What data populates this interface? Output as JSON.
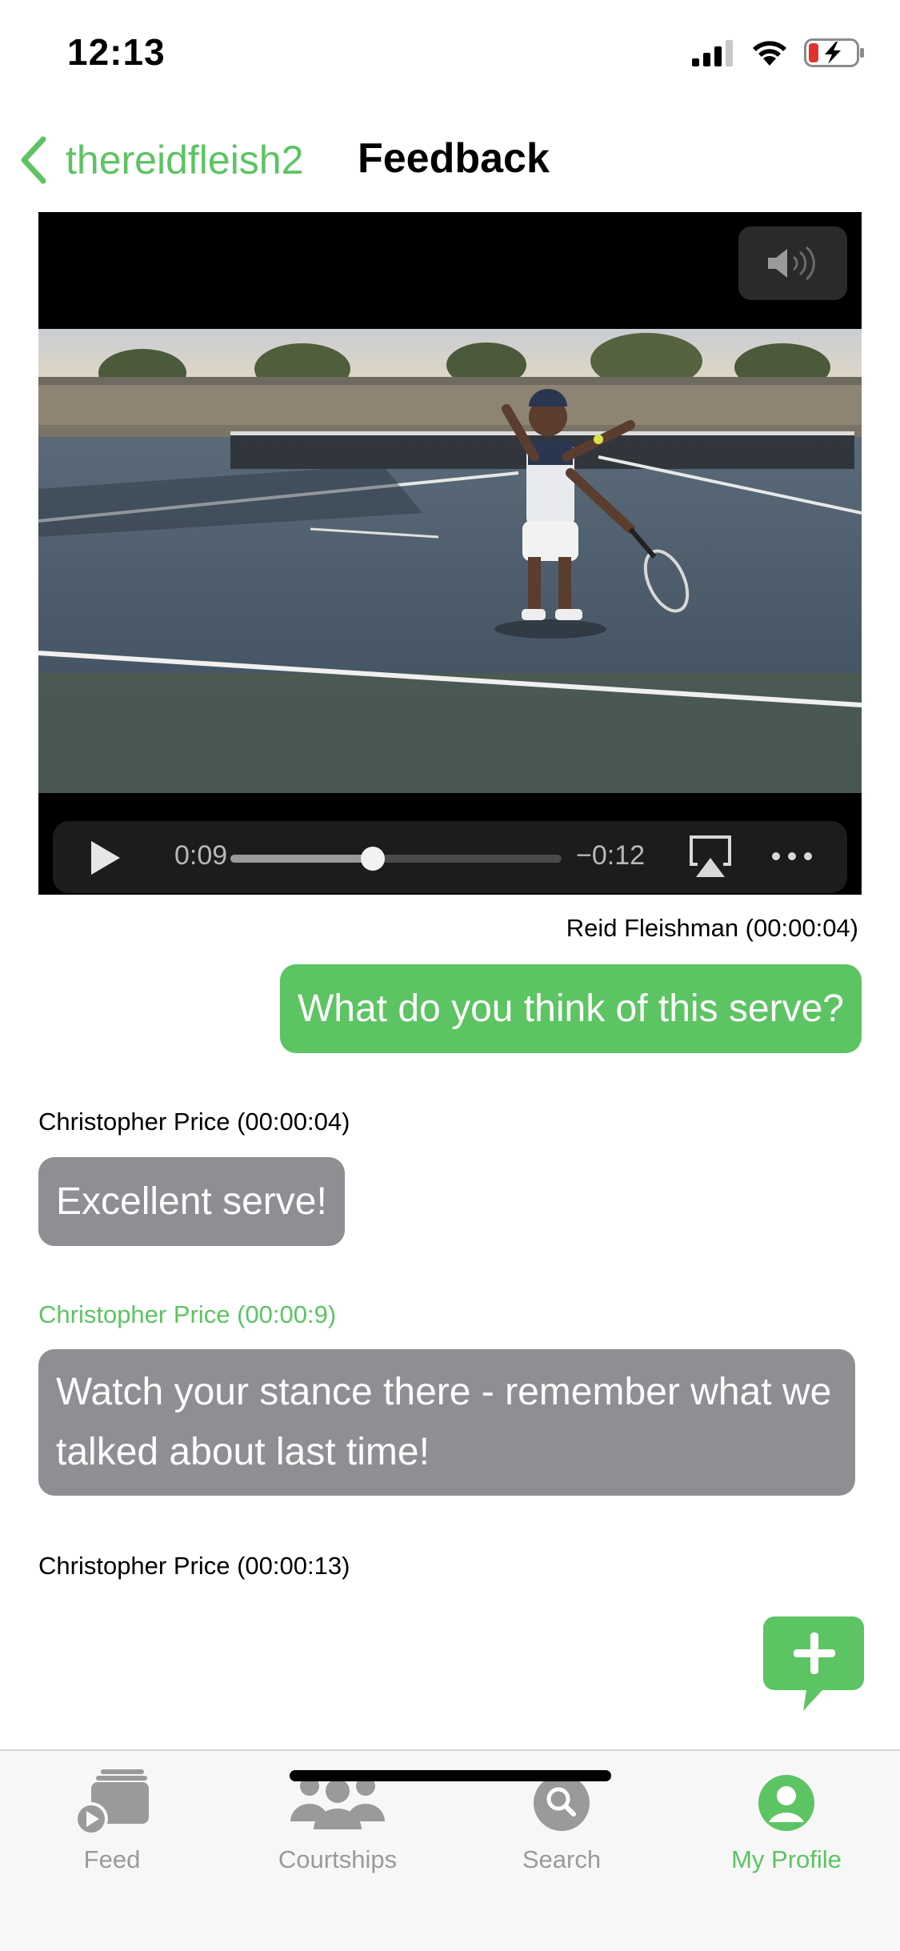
{
  "status_bar": {
    "time": "12:13"
  },
  "nav": {
    "back_label": "thereidfleish2",
    "title": "Feedback"
  },
  "video": {
    "current_time": "0:09",
    "remaining_time": "−0:12",
    "progress": 0.43
  },
  "messages": [
    {
      "author_line": "Reid Fleishman (00:00:04)",
      "text": "What do you think of this serve?",
      "direction": "outgoing"
    },
    {
      "author_line": "Christopher Price (00:00:04)",
      "text": "Excellent serve!",
      "direction": "incoming"
    },
    {
      "author_line": "Christopher Price (00:00:9)",
      "text": "Watch your stance there - remember what we talked about last time!",
      "direction": "incoming",
      "highlighted": true
    },
    {
      "author_line": "Christopher Price (00:00:13)",
      "text": "",
      "direction": "incoming"
    }
  ],
  "tabbar": {
    "tabs": [
      {
        "label": "Feed",
        "icon": "feed-icon",
        "active": false
      },
      {
        "label": "Courtships",
        "icon": "group-icon",
        "active": false
      },
      {
        "label": "Search",
        "icon": "search-icon",
        "active": false
      },
      {
        "label": "My Profile",
        "icon": "profile-icon",
        "active": true
      }
    ]
  },
  "colors": {
    "accent": "#5cc462",
    "incoming_bubble": "#8e8e93",
    "tab_inactive": "#9a9a9a"
  }
}
